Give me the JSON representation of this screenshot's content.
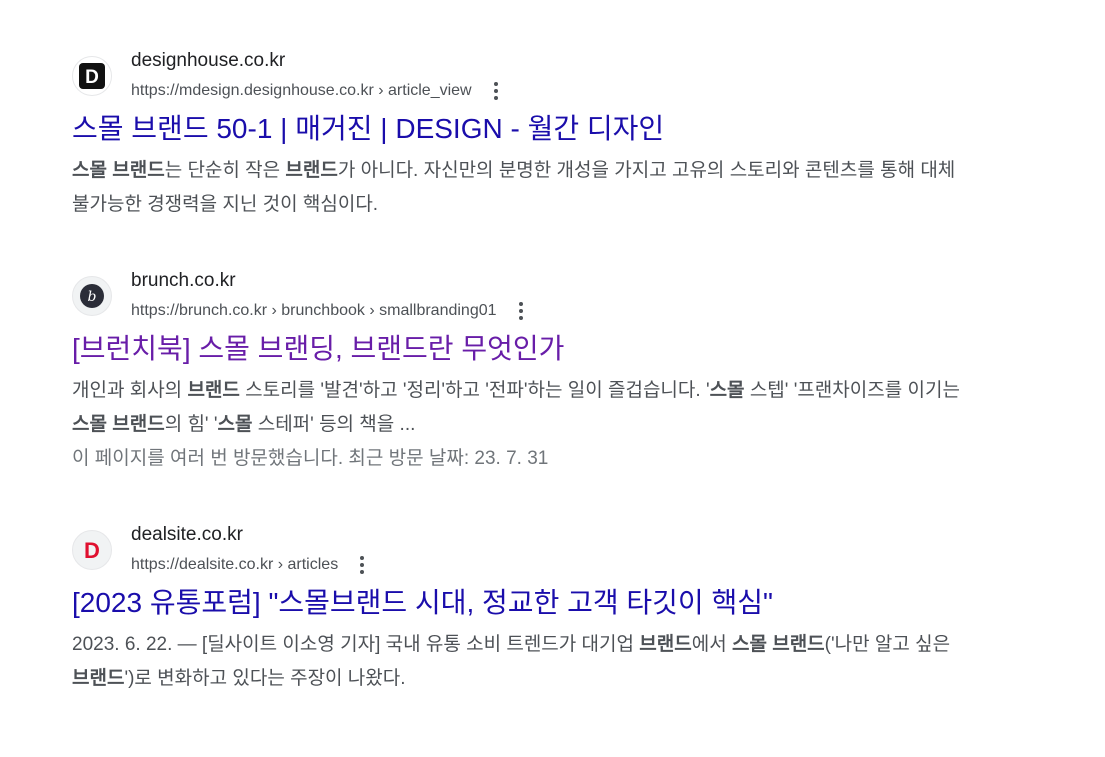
{
  "results": [
    {
      "site_name": "designhouse.co.kr",
      "url": "https://mdesign.designhouse.co.kr › article_view",
      "favicon_letter": "D",
      "favicon_icon": "designhouse-logo-icon",
      "title": "스몰 브랜드 50-1 | 매거진 | DESIGN - 월간 디자인",
      "snippet": [
        {
          "t": "스몰 브랜드",
          "b": true
        },
        {
          "t": "는 단순히 작은 ",
          "b": false
        },
        {
          "t": "브랜드",
          "b": true
        },
        {
          "t": "가 아니다. 자신만의 분명한 개성을 가지고 고유의 스토리와 콘텐츠를 통해 대체 불가능한 경쟁력을 지닌 것이 핵심이다.",
          "b": false
        }
      ]
    },
    {
      "site_name": "brunch.co.kr",
      "url": "https://brunch.co.kr › brunchbook › smallbranding01",
      "favicon_letter": "b",
      "favicon_icon": "brunch-logo-icon",
      "title": "[브런치북] 스몰 브랜딩, 브랜드란 무엇인가",
      "snippet": [
        {
          "t": "개인과 회사의 ",
          "b": false
        },
        {
          "t": "브랜드",
          "b": true
        },
        {
          "t": " 스토리를 '발견'하고 '정리'하고 '전파'하는 일이 즐겁습니다. '",
          "b": false
        },
        {
          "t": "스몰",
          "b": true
        },
        {
          "t": " 스텝' '프랜차이즈를 이기는 ",
          "b": false
        },
        {
          "t": "스몰 브랜드",
          "b": true
        },
        {
          "t": "의 힘' '",
          "b": false
        },
        {
          "t": "스몰",
          "b": true
        },
        {
          "t": " 스테퍼' 등의 책을 ...",
          "b": false
        }
      ],
      "visit_note": "이 페이지를 여러 번 방문했습니다. 최근 방문 날짜: 23. 7. 31"
    },
    {
      "site_name": "dealsite.co.kr",
      "url": "https://dealsite.co.kr › articles",
      "favicon_letter": "D",
      "favicon_icon": "dealsite-logo-icon",
      "title": "[2023 유통포럼] \"스몰브랜드 시대, 정교한 고객 타깃이 핵심\"",
      "snippet": [
        {
          "t": "2023. 6. 22. — [딜사이트 이소영 기자] 국내 유통 소비 트렌드가 대기업 ",
          "b": false
        },
        {
          "t": "브랜드",
          "b": true
        },
        {
          "t": "에서 ",
          "b": false
        },
        {
          "t": "스몰 브랜드",
          "b": true
        },
        {
          "t": "('나만 알고 싶은 ",
          "b": false
        },
        {
          "t": "브랜드",
          "b": true
        },
        {
          "t": "')로 변화하고 있다는 주장이 나왔다.",
          "b": false
        }
      ]
    }
  ],
  "colors": {
    "link": "#1a0dab",
    "visited": "#681da8",
    "snippet": "#4d5156",
    "dealsite_red": "#e0102f"
  }
}
